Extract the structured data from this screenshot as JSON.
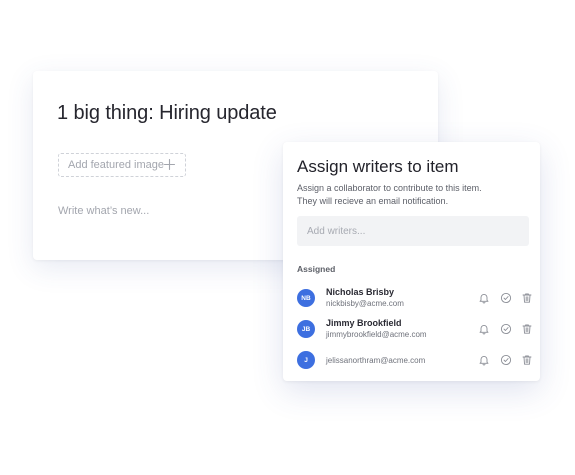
{
  "editor": {
    "title": "1 big thing: Hiring update",
    "featured_image_label": "Add featured image",
    "body_placeholder": "Write what’s new..."
  },
  "assign_panel": {
    "title": "Assign writers to item",
    "description_lines": [
      "Assign a collaborator to contribute to this item.",
      "They will recieve an email notification."
    ],
    "search_placeholder": "Add writers...",
    "assigned_heading": "Assigned",
    "writers": [
      {
        "initials": "NB",
        "name": "Nicholas Brisby",
        "email": "nickbisby@acme.com"
      },
      {
        "initials": "JB",
        "name": "Jimmy Brookfield",
        "email": "jimmybrookfield@acme.com"
      },
      {
        "initials": "J",
        "name": "",
        "email": "jelissanorthram@acme.com"
      }
    ],
    "row_actions": [
      "bell-icon",
      "check-circle-icon",
      "trash-icon"
    ]
  },
  "colors": {
    "avatar": "#3d6fe0",
    "dashed_border": "#cfd2d8",
    "search_background": "#f2f3f5",
    "icon": "#8b8e96"
  }
}
